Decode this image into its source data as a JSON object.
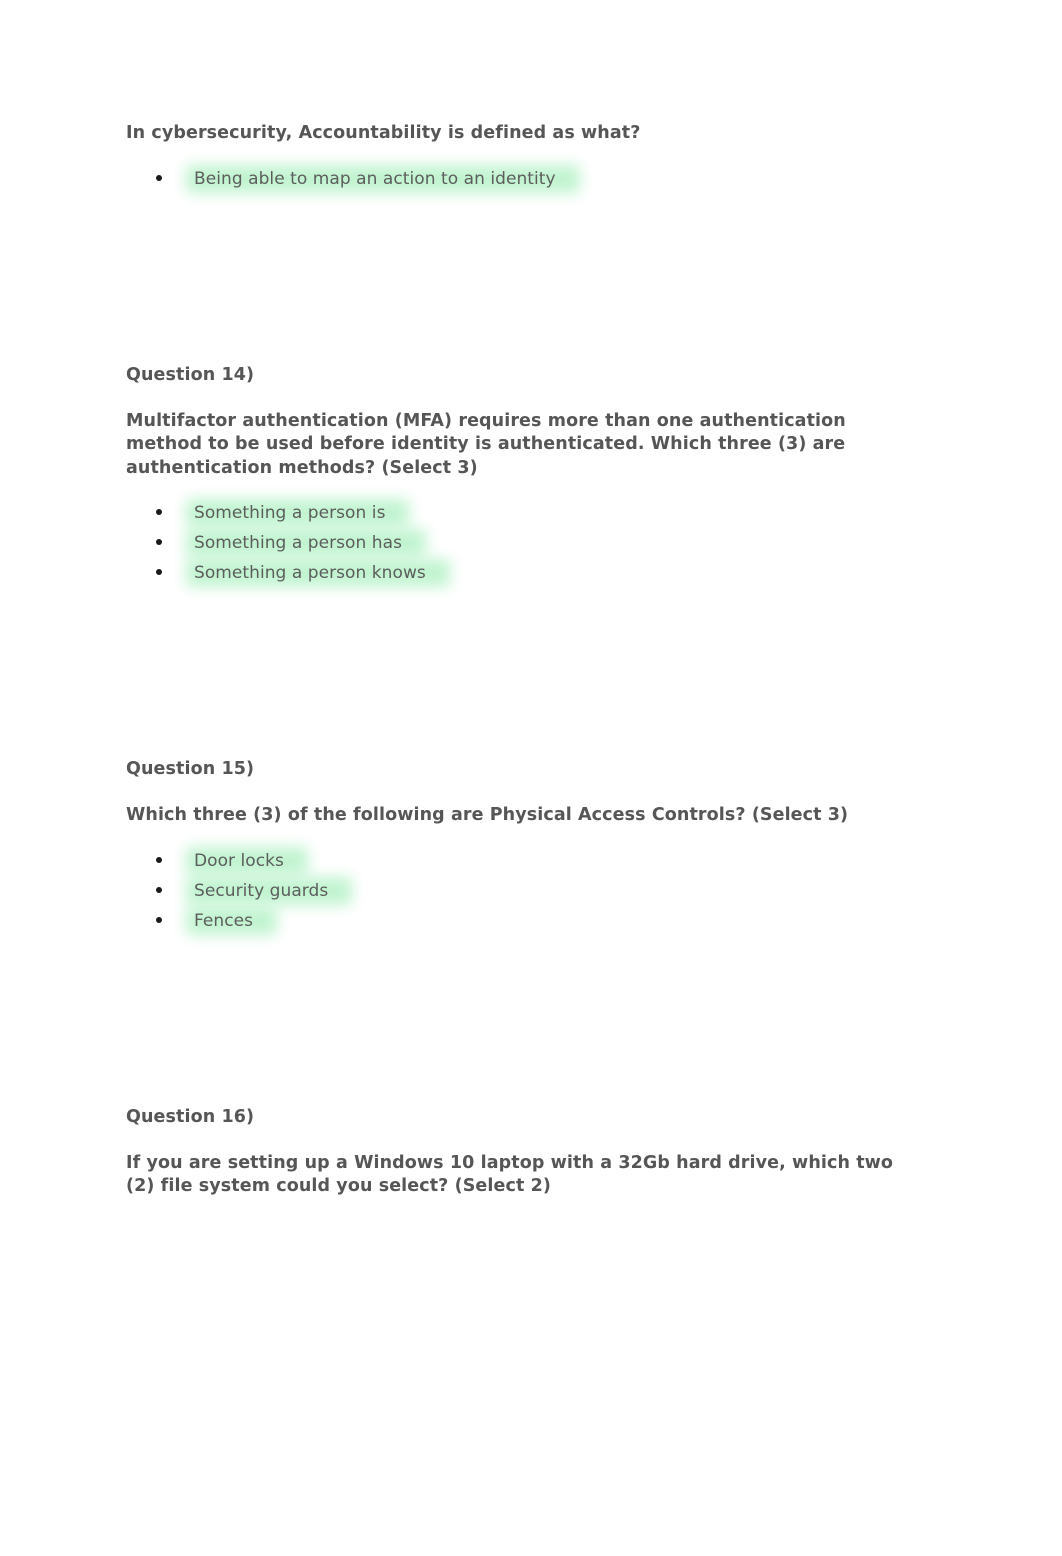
{
  "document": {
    "title": "Cybersecurity quiz answers",
    "text_color": "#565656",
    "answer_color": "#5d5d5d",
    "highlight_color": "#b6f2c8",
    "background_color": "#ffffff"
  },
  "sections": [
    {
      "label": "",
      "question": "In cybersecurity, Accountability is defined as what?",
      "answers": [
        "Being able to map an action to an identity"
      ]
    },
    {
      "label": "Question 14)",
      "question": "Multifactor authentication (MFA) requires more than one authentication method to be used before identity is authenticated. Which three (3) are authentication methods? (Select 3)",
      "answers": [
        "Something a person is",
        "Something a person has",
        "Something a person knows"
      ]
    },
    {
      "label": "Question 15)",
      "question": "Which three (3) of the following are Physical Access Controls? (Select 3)",
      "answers": [
        "Door locks",
        "Security guards",
        "Fences"
      ]
    },
    {
      "label": "Question 16)",
      "question": "If you are setting up a Windows 10 laptop with a 32Gb hard drive, which two (2) file system could you select? (Select 2)",
      "answers": []
    }
  ]
}
